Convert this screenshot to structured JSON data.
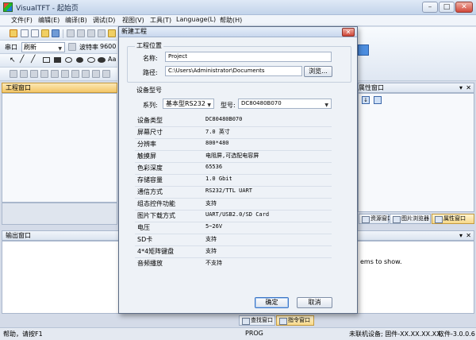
{
  "window": {
    "title": "VisualTFT - 起始页"
  },
  "menu": [
    "文件(F)",
    "编辑(E)",
    "编译(B)",
    "调试(D)",
    "视图(V)",
    "工具(T)",
    "Language(L)",
    "帮助(H)"
  ],
  "toolbar": {
    "port_label": "串口",
    "port_value": "刷新",
    "baud_label": "波特率",
    "baud_value": "9600"
  },
  "panels": {
    "project": "工程窗口",
    "output": "输出窗口",
    "properties": "属性窗口",
    "output_msg": "ems to show."
  },
  "tabs": {
    "right": [
      "资源窗口",
      "图片浏览器",
      "属性窗口"
    ],
    "bottom": [
      "查找窗口",
      "指令窗口"
    ]
  },
  "status": {
    "help": "帮助，请按F1",
    "mode": "PROG",
    "device": "未联机设备; 固件-XX.XX.XX.XX;",
    "software": "软件-3.0.0.6"
  },
  "dialog": {
    "title": "新建工程",
    "location_group": "工程位置",
    "name_label": "名称:",
    "name_value": "Project",
    "path_label": "路径:",
    "path_value": "C:\\Users\\Administrator\\Documents",
    "browse": "浏览...",
    "model_group": "设备型号",
    "series_label": "系列:",
    "series_value": "基本型RS232",
    "model_label": "型号:",
    "model_value": "DC80480B070",
    "specs": [
      {
        "k": "设备类型",
        "v": "DC80480B070"
      },
      {
        "k": "屏幕尺寸",
        "v": "7.0 英寸"
      },
      {
        "k": "分辨率",
        "v": "800*480"
      },
      {
        "k": "触摸屏",
        "v": "电阻屏,可选配电容屏"
      },
      {
        "k": "色彩深度",
        "v": "65536"
      },
      {
        "k": "存储容量",
        "v": "1.0 Gbit"
      },
      {
        "k": "通信方式",
        "v": "RS232/TTL UART"
      },
      {
        "k": "组态控件功能",
        "v": "支持"
      },
      {
        "k": "图片下载方式",
        "v": "UART/USB2.0/SD Card"
      },
      {
        "k": "电压",
        "v": "5~26V"
      },
      {
        "k": "SD卡",
        "v": "支持"
      },
      {
        "k": "4*4矩阵键盘",
        "v": "支持"
      },
      {
        "k": "音频播放",
        "v": "不支持"
      }
    ],
    "ok": "确定",
    "cancel": "取消"
  },
  "colors": {
    "panel_header": "#f4c767",
    "accent": "#3d76c7"
  }
}
